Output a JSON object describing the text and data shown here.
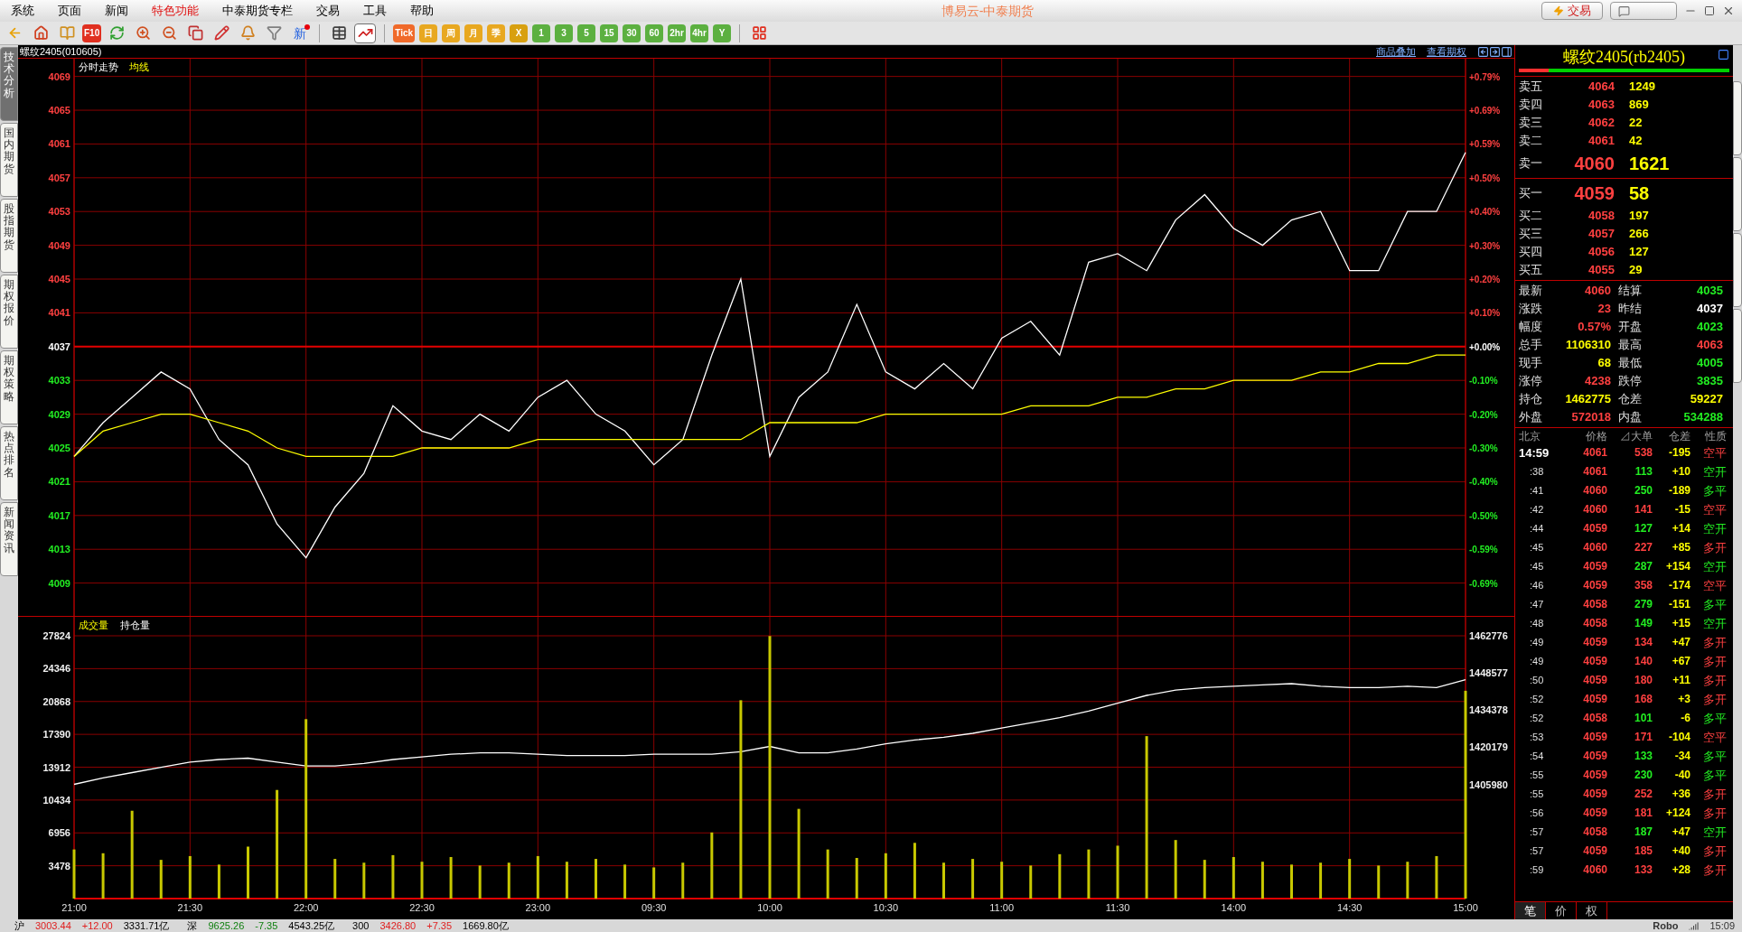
{
  "window": {
    "title": "博易云-中泰期货",
    "buttons": [
      {
        "kind": "trade",
        "label": "交易"
      },
      {
        "kind": "chat"
      }
    ]
  },
  "menu": [
    {
      "label": "系统",
      "highlight": false
    },
    {
      "label": "页面",
      "highlight": false
    },
    {
      "label": "新闻",
      "highlight": false
    },
    {
      "label": "特色功能",
      "highlight": true
    },
    {
      "label": "中泰期货专栏",
      "highlight": false
    },
    {
      "label": "交易",
      "highlight": false
    },
    {
      "label": "工具",
      "highlight": false
    },
    {
      "label": "帮助",
      "highlight": false
    }
  ],
  "toolbar": [
    {
      "kind": "icon",
      "selected": false
    },
    {
      "kind": "icon",
      "selected": false
    },
    {
      "kind": "icon",
      "selected": false
    },
    {
      "kind": "tile",
      "text": "F10",
      "color": "#e03020",
      "selected": false
    },
    {
      "kind": "icon",
      "selected": false
    },
    {
      "kind": "icon",
      "selected": false
    },
    {
      "kind": "icon",
      "selected": false
    },
    {
      "kind": "icon",
      "selected": false
    },
    {
      "kind": "icon",
      "selected": false
    },
    {
      "kind": "icon",
      "selected": false
    },
    {
      "kind": "icon",
      "selected": false
    },
    {
      "kind": "new",
      "text": "新",
      "selected": false
    },
    {
      "kind": "separator"
    },
    {
      "kind": "icon",
      "selected": false
    },
    {
      "kind": "icon",
      "selected": true
    },
    {
      "kind": "separator"
    },
    {
      "kind": "tile",
      "text": "Tick",
      "color": "#f06a2a",
      "selected": false
    },
    {
      "kind": "tile",
      "text": "日",
      "color": "#e8a820",
      "selected": false
    },
    {
      "kind": "tile",
      "text": "周",
      "color": "#e8a820",
      "selected": false
    },
    {
      "kind": "tile",
      "text": "月",
      "color": "#e8a820",
      "selected": false
    },
    {
      "kind": "tile",
      "text": "季",
      "color": "#e8a820",
      "selected": false
    },
    {
      "kind": "tile",
      "text": "X",
      "color": "#d8a010",
      "selected": false
    },
    {
      "kind": "tile",
      "text": "1",
      "color": "#5cb040",
      "selected": false
    },
    {
      "kind": "tile",
      "text": "3",
      "color": "#5cb040",
      "selected": false
    },
    {
      "kind": "tile",
      "text": "5",
      "color": "#5cb040",
      "selected": false
    },
    {
      "kind": "tile",
      "text": "15",
      "color": "#5cb040",
      "selected": false
    },
    {
      "kind": "tile",
      "text": "30",
      "color": "#5cb040",
      "selected": false
    },
    {
      "kind": "tile",
      "text": "60",
      "color": "#5cb040",
      "selected": false
    },
    {
      "kind": "tile",
      "text": "2hr",
      "color": "#5cb040",
      "selected": false
    },
    {
      "kind": "tile",
      "text": "4hr",
      "color": "#5cb040",
      "selected": false
    },
    {
      "kind": "tile",
      "text": "Y",
      "color": "#5cb040",
      "selected": false
    },
    {
      "kind": "separator"
    },
    {
      "kind": "icon",
      "selected": false
    }
  ],
  "left_tabs": [
    {
      "label": "技术分析",
      "selected": true
    },
    {
      "label": "国内期货",
      "selected": false
    },
    {
      "label": "股指期货",
      "selected": false
    },
    {
      "label": "期权报价",
      "selected": false
    },
    {
      "label": "期权策略",
      "selected": false
    },
    {
      "label": "热点排名",
      "selected": false
    },
    {
      "label": "新闻资讯",
      "selected": false
    }
  ],
  "chart_header": {
    "title": "螺纹2405(010605)",
    "links": [
      "商品叠加",
      "查看期权"
    ]
  },
  "price_panel": {
    "percent_labels": [
      "+0.79%",
      "+0.69%",
      "+0.59%",
      "+0.50%",
      "+0.40%",
      "+0.30%",
      "+0.20%",
      "+0.10%",
      "+0.00%",
      "-0.10%",
      "-0.20%",
      "-0.30%",
      "-0.40%",
      "-0.50%",
      "-0.59%",
      "-0.69%"
    ],
    "chart_data": {
      "type": "line",
      "grid": true,
      "ylim": [
        4005,
        4071.1
      ],
      "yticks": [
        {
          "value": 4069,
          "label": "4069"
        },
        {
          "value": 4065,
          "label": "4065"
        },
        {
          "value": 4061,
          "label": "4061"
        },
        {
          "value": 4057,
          "label": "4057"
        },
        {
          "value": 4053,
          "label": "4053"
        },
        {
          "value": 4049,
          "label": "4049"
        },
        {
          "value": 4045,
          "label": "4045"
        },
        {
          "value": 4041,
          "label": "4041"
        },
        {
          "value": 4037,
          "label": "4037"
        },
        {
          "value": 4033,
          "label": "4033"
        },
        {
          "value": 4029,
          "label": "4029"
        },
        {
          "value": 4025,
          "label": "4025"
        },
        {
          "value": 4021,
          "label": "4021"
        },
        {
          "value": 4017,
          "label": "4017"
        },
        {
          "value": 4013,
          "label": "4013"
        },
        {
          "value": 4009,
          "label": "4009"
        }
      ],
      "ref_lines": [
        {
          "axis": "y",
          "value": 4037
        }
      ],
      "series": [
        {
          "name": "分时走势",
          "color": "#ffffff",
          "values": [
            4024,
            4028,
            4031,
            4034,
            4032,
            4026,
            4023,
            4016,
            4012,
            4018,
            4022,
            4030,
            4027,
            4026,
            4029,
            4027,
            4031,
            4033,
            4029,
            4027,
            4023,
            4026,
            4036,
            4045,
            4024,
            4031,
            4034,
            4042,
            4034,
            4032,
            4035,
            4032,
            4038,
            4040,
            4036,
            4047,
            4048,
            4046,
            4052,
            4055,
            4051,
            4049,
            4052,
            4053,
            4046,
            4046,
            4053,
            4053,
            4060
          ]
        },
        {
          "name": "均线",
          "color": "#ffff00",
          "values": [
            4024,
            4027,
            4028,
            4029,
            4029,
            4028,
            4027,
            4025,
            4024,
            4024,
            4024,
            4024,
            4025,
            4025,
            4025,
            4025,
            4026,
            4026,
            4026,
            4026,
            4026,
            4026,
            4026,
            4026,
            4028,
            4028,
            4028,
            4028,
            4029,
            4029,
            4029,
            4029,
            4029,
            4030,
            4030,
            4030,
            4031,
            4031,
            4032,
            4032,
            4033,
            4033,
            4033,
            4034,
            4034,
            4035,
            4035,
            4036,
            4036
          ]
        }
      ]
    }
  },
  "volume_panel": {
    "chart_data": {
      "type": "bar",
      "categories": [
        "21:00",
        null,
        null,
        null,
        "21:30",
        null,
        null,
        null,
        "22:00",
        null,
        null,
        null,
        "22:30",
        null,
        null,
        null,
        "23:00",
        null,
        null,
        null,
        "09:30",
        null,
        null,
        null,
        "10:00",
        null,
        null,
        null,
        "10:30",
        null,
        null,
        null,
        "11:00",
        null,
        null,
        null,
        "11:30",
        null,
        null,
        null,
        "14:00",
        null,
        null,
        null,
        "14:30",
        null,
        null,
        null,
        "15:00"
      ],
      "grid": true,
      "ylim": [
        0,
        29832
      ],
      "yticks": [
        {
          "value": 27824,
          "label": "27824"
        },
        {
          "value": 24346,
          "label": "24346"
        },
        {
          "value": 20868,
          "label": "20868"
        },
        {
          "value": 17390,
          "label": "17390"
        },
        {
          "value": 13912,
          "label": "13912"
        },
        {
          "value": 10434,
          "label": "10434"
        },
        {
          "value": 6956,
          "label": "6956"
        },
        {
          "value": 3478,
          "label": "3478"
        }
      ],
      "series": [
        {
          "name": "成交量",
          "color": "#c8c800",
          "values": [
            5200,
            4800,
            9300,
            4100,
            4500,
            3600,
            5500,
            11500,
            19000,
            4200,
            3800,
            4600,
            3900,
            4400,
            3500,
            3800,
            4500,
            3900,
            4200,
            3600,
            3300,
            3800,
            7000,
            21000,
            27800,
            9500,
            5200,
            4300,
            4800,
            5900,
            3800,
            4200,
            3900,
            3500,
            4700,
            5200,
            5600,
            17200,
            6200,
            4100,
            4400,
            3900,
            3600,
            3800,
            4200,
            3500,
            3900,
            4500,
            22000
          ]
        }
      ]
    },
    "open_interest": {
      "chart_data": {
        "type": "line",
        "ylim": [
          1362350,
          1470023
        ],
        "yticks": [
          {
            "value": 1462776,
            "label": "1462776"
          },
          {
            "value": 1448577,
            "label": "1448577"
          },
          {
            "value": 1434378,
            "label": "1434378"
          },
          {
            "value": 1420179,
            "label": "1420179"
          },
          {
            "value": 1405980,
            "label": "1405980"
          }
        ],
        "series": [
          {
            "name": "持仓量",
            "color": "#ffffff",
            "values": [
              1406000,
              1408500,
              1410500,
              1412500,
              1414500,
              1415500,
              1416000,
              1414500,
              1413000,
              1413000,
              1414000,
              1415500,
              1416500,
              1417500,
              1418000,
              1418000,
              1417500,
              1417000,
              1417000,
              1417000,
              1417500,
              1417500,
              1417500,
              1418500,
              1420500,
              1418000,
              1418000,
              1419500,
              1421500,
              1423000,
              1424000,
              1425500,
              1427500,
              1429500,
              1431500,
              1434000,
              1437000,
              1440000,
              1442000,
              1443000,
              1443500,
              1444000,
              1444500,
              1443500,
              1443000,
              1443000,
              1443500,
              1443000,
              1446000
            ]
          }
        ]
      }
    }
  },
  "quote": {
    "title": "螺纹2405(rb2405)",
    "ratio": {
      "level": 0.14
    },
    "asks": [
      {
        "label": "卖五",
        "price": "4064",
        "volume": "1249",
        "kind": "normal"
      },
      {
        "label": "卖四",
        "price": "4063",
        "volume": "869",
        "kind": "normal"
      },
      {
        "label": "卖三",
        "price": "4062",
        "volume": "22",
        "kind": "normal"
      },
      {
        "label": "卖二",
        "price": "4061",
        "volume": "42",
        "kind": "normal"
      },
      {
        "label": "卖一",
        "price": "4060",
        "volume": "1621",
        "kind": "best"
      }
    ],
    "bids": [
      {
        "label": "买一",
        "price": "4059",
        "volume": "58",
        "kind": "best"
      },
      {
        "label": "买二",
        "price": "4058",
        "volume": "197",
        "kind": "normal"
      },
      {
        "label": "买三",
        "price": "4057",
        "volume": "266",
        "kind": "normal"
      },
      {
        "label": "买四",
        "price": "4056",
        "volume": "127",
        "kind": "normal"
      },
      {
        "label": "买五",
        "price": "4055",
        "volume": "29",
        "kind": "normal"
      }
    ],
    "stats": [
      {
        "label": "最新",
        "value": "4060",
        "color": "#ff4040"
      },
      {
        "label": "结算",
        "value": "4035",
        "color": "#22ee22"
      },
      {
        "label": "涨跌",
        "value": "23",
        "color": "#ff4040"
      },
      {
        "label": "昨结",
        "value": "4037",
        "color": "#ffffff"
      },
      {
        "label": "幅度",
        "value": "0.57%",
        "color": "#ff4040"
      },
      {
        "label": "开盘",
        "value": "4023",
        "color": "#22ee22"
      },
      {
        "label": "总手",
        "value": "1106310",
        "color": "#ffff00"
      },
      {
        "label": "最高",
        "value": "4063",
        "color": "#ff4040"
      },
      {
        "label": "现手",
        "value": "68",
        "color": "#ffff00"
      },
      {
        "label": "最低",
        "value": "4005",
        "color": "#22ee22"
      },
      {
        "label": "涨停",
        "value": "4238",
        "color": "#ff4040"
      },
      {
        "label": "跌停",
        "value": "3835",
        "color": "#22ee22"
      },
      {
        "label": "持仓",
        "value": "1462775",
        "color": "#ffff00"
      },
      {
        "label": "仓差",
        "value": "59227",
        "color": "#ffff00"
      },
      {
        "label": "外盘",
        "value": "572018",
        "color": "#ff4040"
      },
      {
        "label": "内盘",
        "value": "534288",
        "color": "#22ee22"
      }
    ],
    "trade_columns": [
      "北京",
      "价格",
      "⊿大单",
      "仓差",
      "性质"
    ],
    "trades": [
      {
        "time": "14:59",
        "price": "4061",
        "volume": "538",
        "change": "-195",
        "type": "空平",
        "color": "#ff4040"
      },
      {
        "time": ":38",
        "price": "4061",
        "volume": "113",
        "change": "+10",
        "type": "空开",
        "color": "#22ee22"
      },
      {
        "time": ":41",
        "price": "4060",
        "volume": "250",
        "change": "-189",
        "type": "多平",
        "color": "#22ee22"
      },
      {
        "time": ":42",
        "price": "4060",
        "volume": "141",
        "change": "-15",
        "type": "空平",
        "color": "#ff4040"
      },
      {
        "time": ":44",
        "price": "4059",
        "volume": "127",
        "change": "+14",
        "type": "空开",
        "color": "#22ee22"
      },
      {
        "time": ":45",
        "price": "4060",
        "volume": "227",
        "change": "+85",
        "type": "多开",
        "color": "#ff4040"
      },
      {
        "time": ":45",
        "price": "4059",
        "volume": "287",
        "change": "+154",
        "type": "空开",
        "color": "#22ee22"
      },
      {
        "time": ":46",
        "price": "4059",
        "volume": "358",
        "change": "-174",
        "type": "空平",
        "color": "#ff4040"
      },
      {
        "time": ":47",
        "price": "4058",
        "volume": "279",
        "change": "-151",
        "type": "多平",
        "color": "#22ee22"
      },
      {
        "time": ":48",
        "price": "4058",
        "volume": "149",
        "change": "+15",
        "type": "空开",
        "color": "#22ee22"
      },
      {
        "time": ":49",
        "price": "4059",
        "volume": "134",
        "change": "+47",
        "type": "多开",
        "color": "#ff4040"
      },
      {
        "time": ":49",
        "price": "4059",
        "volume": "140",
        "change": "+67",
        "type": "多开",
        "color": "#ff4040"
      },
      {
        "time": ":50",
        "price": "4059",
        "volume": "180",
        "change": "+11",
        "type": "多开",
        "color": "#ff4040"
      },
      {
        "time": ":52",
        "price": "4059",
        "volume": "168",
        "change": "+3",
        "type": "多开",
        "color": "#ff4040"
      },
      {
        "time": ":52",
        "price": "4058",
        "volume": "101",
        "change": "-6",
        "type": "多平",
        "color": "#22ee22"
      },
      {
        "time": ":53",
        "price": "4059",
        "volume": "171",
        "change": "-104",
        "type": "空平",
        "color": "#ff4040"
      },
      {
        "time": ":54",
        "price": "4059",
        "volume": "133",
        "change": "-34",
        "type": "多平",
        "color": "#22ee22"
      },
      {
        "time": ":55",
        "price": "4059",
        "volume": "230",
        "change": "-40",
        "type": "多平",
        "color": "#22ee22"
      },
      {
        "time": ":55",
        "price": "4059",
        "volume": "252",
        "change": "+36",
        "type": "多开",
        "color": "#ff4040"
      },
      {
        "time": ":56",
        "price": "4059",
        "volume": "181",
        "change": "+124",
        "type": "多开",
        "color": "#ff4040"
      },
      {
        "time": ":57",
        "price": "4058",
        "volume": "187",
        "change": "+47",
        "type": "空开",
        "color": "#22ee22"
      },
      {
        "time": ":57",
        "price": "4059",
        "volume": "185",
        "change": "+40",
        "type": "多开",
        "color": "#ff4040"
      },
      {
        "time": ":59",
        "price": "4060",
        "volume": "133",
        "change": "+28",
        "type": "多开",
        "color": "#ff4040"
      }
    ],
    "bottom_tabs": [
      {
        "label": "笔",
        "selected": true
      },
      {
        "label": "价",
        "selected": false
      },
      {
        "label": "权",
        "selected": false
      }
    ]
  },
  "status_bar": {
    "indices": [
      {
        "name": "沪",
        "value": "3003.44",
        "change": "+12.00",
        "amount": "3331.71亿",
        "color": "#e02020"
      },
      {
        "name": "深",
        "value": "9625.26",
        "change": "-7.35",
        "amount": "4543.25亿",
        "color": "#108010"
      },
      {
        "name": "300",
        "value": "3426.80",
        "change": "+7.35",
        "amount": "1669.80亿",
        "color": "#e02020"
      }
    ],
    "brand": "Robo",
    "time": "15:09"
  }
}
